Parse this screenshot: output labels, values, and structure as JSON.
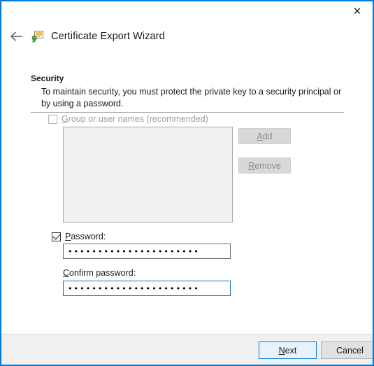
{
  "window": {
    "title": "Certificate Export Wizard",
    "border_color": "#0078d7",
    "close_icon": "close-icon",
    "back_icon": "back-arrow-icon",
    "wizard_icon": "certificate-export-icon"
  },
  "page": {
    "heading": "Security",
    "description": "To maintain security, you must protect the private key to a security principal or by using a password."
  },
  "group_section": {
    "checkbox_label_prefix": "",
    "checkbox_accel": "G",
    "checkbox_label_rest": "roup or user names (recommended)",
    "checkbox_checked": false,
    "checkbox_enabled": false,
    "listbox_items": [],
    "add_accel": "A",
    "add_label_prefix": "",
    "add_label_rest": "dd",
    "add_enabled": false,
    "remove_accel": "R",
    "remove_label_prefix": "",
    "remove_label_rest": "emove",
    "remove_enabled": false
  },
  "password_section": {
    "checkbox_checked": true,
    "checkbox_accel": "P",
    "checkbox_label_prefix": "",
    "checkbox_label_rest": "assword:",
    "password_value": "••••••••••••••••••••••",
    "confirm_accel": "C",
    "confirm_label_prefix": "",
    "confirm_label_rest": "onfirm password:",
    "confirm_value": "••••••••••••••••••••••",
    "confirm_focused": true,
    "focus_color": "#0078d7"
  },
  "footer": {
    "next_accel": "N",
    "next_label_prefix": "",
    "next_label_rest": "ext",
    "next_is_default": true,
    "cancel_label": "Cancel"
  }
}
